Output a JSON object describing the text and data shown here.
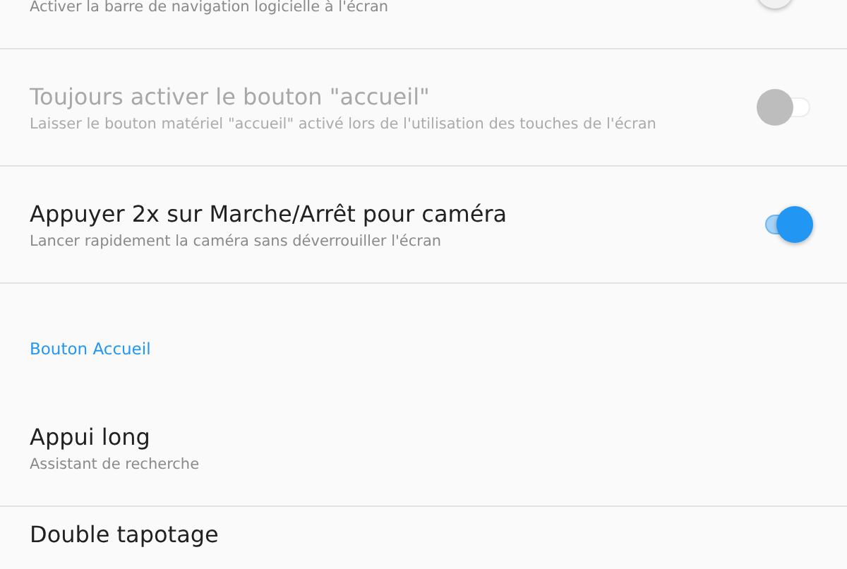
{
  "settings": [
    {
      "kind": "toggle",
      "subtitle": "Activer la barre de navigation logicielle à l'écran",
      "on": false,
      "disabled": false
    },
    {
      "kind": "toggle",
      "title": "Toujours activer le bouton \"accueil\"",
      "subtitle": "Laisser le bouton matériel \"accueil\" activé lors de l'utilisation des touches de l'écran",
      "on": false,
      "disabled": true
    },
    {
      "kind": "toggle",
      "title": "Appuyer 2x sur Marche/Arrêt pour caméra",
      "subtitle": "Lancer rapidement la caméra sans déverrouiller l'écran",
      "on": true,
      "disabled": false
    },
    {
      "kind": "header",
      "title": "Bouton Accueil"
    },
    {
      "kind": "link",
      "title": "Appui long",
      "subtitle": "Assistant de recherche"
    },
    {
      "kind": "link",
      "title": "Double tapotage"
    }
  ]
}
